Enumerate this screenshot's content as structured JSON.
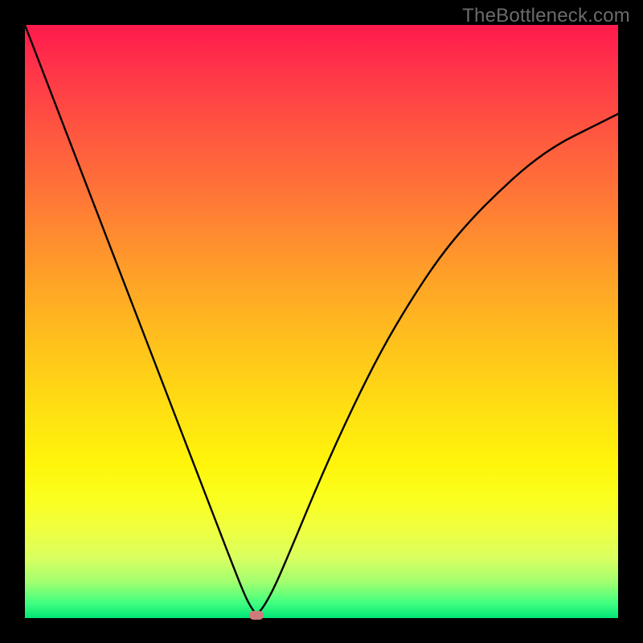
{
  "watermark": "TheBottleneck.com",
  "colors": {
    "frame": "#000000",
    "curve": "#000000",
    "marker": "#cf7a7a",
    "gradient_top": "#ff1a4d",
    "gradient_bottom": "#00e676"
  },
  "chart_data": {
    "type": "line",
    "title": "",
    "xlabel": "",
    "ylabel": "",
    "xlim": [
      0,
      100
    ],
    "ylim": [
      0,
      100
    ],
    "grid": false,
    "series": [
      {
        "name": "bottleneck-curve",
        "x": [
          0,
          5,
          10,
          15,
          20,
          25,
          30,
          35,
          37,
          38,
          39,
          40,
          42,
          45,
          50,
          55,
          60,
          65,
          70,
          75,
          80,
          85,
          90,
          95,
          100
        ],
        "values": [
          100,
          87,
          74,
          61,
          48,
          35,
          22,
          9,
          4,
          2,
          0.6,
          1.5,
          5,
          12,
          24,
          35,
          45,
          53.5,
          61,
          67,
          72,
          76.5,
          80,
          82.5,
          85
        ]
      }
    ],
    "annotations": [
      {
        "name": "sweet-spot-marker",
        "x": 39,
        "y": 0.5
      }
    ]
  }
}
